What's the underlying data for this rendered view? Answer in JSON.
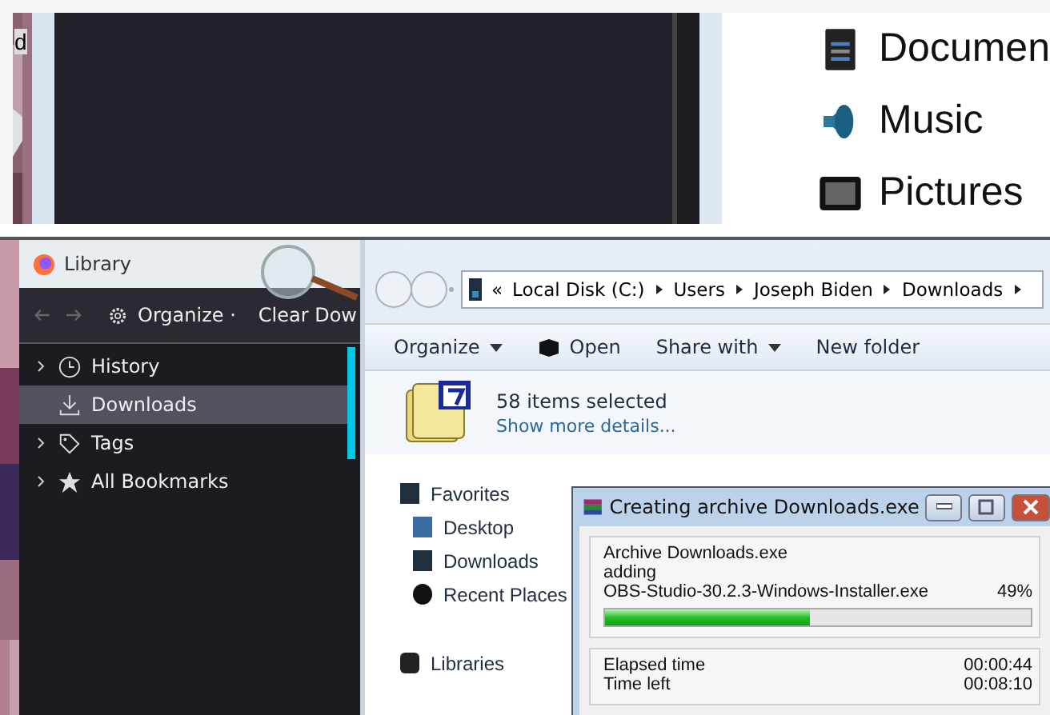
{
  "zoomed_view": {
    "cut_text": "d",
    "items": [
      {
        "label": "Documen",
        "kind": "documents"
      },
      {
        "label": "Music",
        "kind": "music"
      },
      {
        "label": "Pictures",
        "kind": "pictures"
      }
    ]
  },
  "library": {
    "title": "Library",
    "organize": "Organize",
    "organize_caret": "·",
    "clear": "Clear Dow",
    "tree": [
      {
        "label": "History",
        "kind": "history",
        "expandable": true,
        "selected": false
      },
      {
        "label": "Downloads",
        "kind": "downloads",
        "expandable": false,
        "selected": true
      },
      {
        "label": "Tags",
        "kind": "tags",
        "expandable": true,
        "selected": false
      },
      {
        "label": "All Bookmarks",
        "kind": "bookmarks",
        "expandable": true,
        "selected": false
      }
    ]
  },
  "explorer": {
    "breadcrumb_prefix": "«",
    "breadcrumb": [
      "Local Disk (C:)",
      "Users",
      "Joseph Biden",
      "Downloads"
    ],
    "toolbar": [
      {
        "label": "Organize",
        "kind": "menu"
      },
      {
        "label": "Open",
        "kind": "open"
      },
      {
        "label": "Share with",
        "kind": "menu"
      },
      {
        "label": "New folder",
        "kind": "plain"
      }
    ],
    "selection": "58 items selected",
    "details_link": "Show more details...",
    "nav": [
      {
        "label": "Favorites",
        "kind": "favorites",
        "children": [
          {
            "label": "Desktop",
            "kind": "desktop"
          },
          {
            "label": "Downloads",
            "kind": "downloads"
          },
          {
            "label": "Recent Places",
            "kind": "recent"
          }
        ]
      },
      {
        "label": "Libraries",
        "kind": "libraries"
      }
    ]
  },
  "dialog": {
    "title": "Creating archive Downloads.exe",
    "archive": "Archive Downloads.exe",
    "action": "adding",
    "file": "OBS-Studio-30.2.3-Windows-Installer.exe",
    "percent": "49%",
    "level": 0.48,
    "stats": [
      {
        "label": "Elapsed time",
        "value": "00:00:44"
      },
      {
        "label": "Time left",
        "value": "00:08:10"
      }
    ]
  }
}
